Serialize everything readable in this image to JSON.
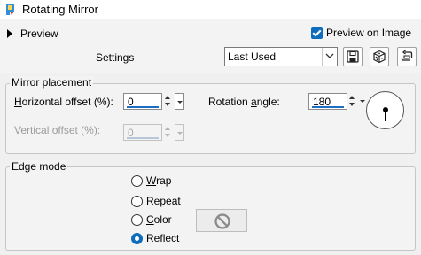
{
  "window": {
    "title": "Rotating Mirror",
    "icon": "app-icon"
  },
  "header": {
    "preview_label": "Preview",
    "preview_on_image_label": "Preview on Image",
    "preview_on_image_checked": true,
    "settings_label": "Settings",
    "preset_value": "Last Used",
    "tools": [
      "save-preset-icon",
      "randomize-dice-icon",
      "reset-icon"
    ]
  },
  "mirror_placement": {
    "title": "Mirror placement",
    "horizontal_label_prefix": "",
    "horizontal_label_mnemonic": "H",
    "horizontal_label_rest": "orizontal offset (%):",
    "horizontal_value": "0",
    "vertical_label_mnemonic": "V",
    "vertical_label_rest": "ertical offset (%):",
    "vertical_value": "0",
    "rotation_label_prefix": "Rotation ",
    "rotation_label_mnemonic": "a",
    "rotation_label_rest": "ngle:",
    "rotation_value": "180",
    "rotation_dial_icon": "angle-dial-icon"
  },
  "edge_mode": {
    "title": "Edge mode",
    "options": [
      {
        "mnemonic": "W",
        "rest": "rap",
        "checked": false
      },
      {
        "mnemonic": "",
        "rest": "Repeat",
        "checked": false
      },
      {
        "mnemonic": "C",
        "rest": "olor",
        "checked": false
      },
      {
        "mnemonic": "e",
        "prefix": "R",
        "rest": "flect",
        "checked": true
      }
    ],
    "color_swatch_icon": "no-color-icon"
  },
  "colors": {
    "accent": "#0f6cbd",
    "input_underline": "#1e6fc4",
    "background": "#f0f0f0"
  }
}
